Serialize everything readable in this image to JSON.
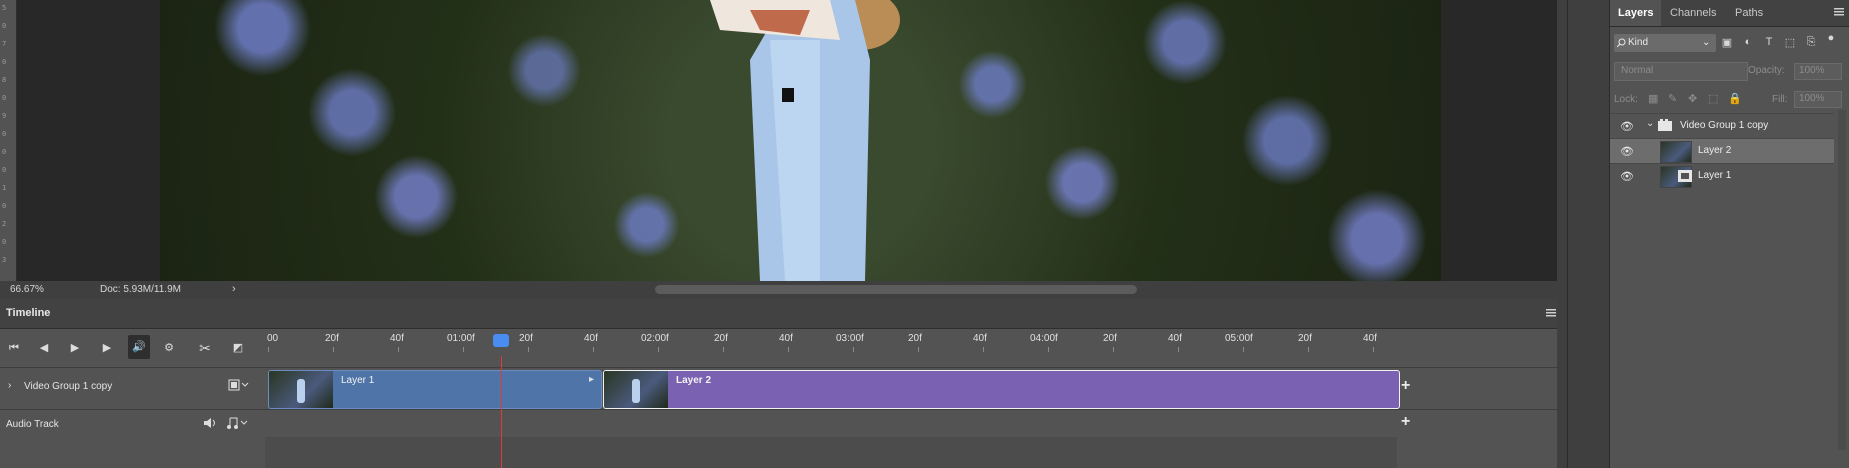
{
  "canvas": {
    "ruler_labels": [
      "5",
      "0",
      "7",
      "0",
      "8",
      "0",
      "9",
      "0",
      "0",
      "0",
      "1",
      "0",
      "2",
      "0",
      "3"
    ]
  },
  "status_bar": {
    "zoom": "66.67%",
    "doc_size": "Doc: 5.93M/11.9M",
    "arrow": "›"
  },
  "timeline": {
    "title": "Timeline",
    "controls": {
      "go_first": "⏮",
      "prev_frame": "◀",
      "play": "▶",
      "next_frame": "▶",
      "mute": "🔊",
      "settings": "⚙",
      "split": "✂",
      "transition": "◩"
    },
    "ruler": [
      "00",
      "20f",
      "40f",
      "01:00f",
      "20f",
      "40f",
      "02:00f",
      "20f",
      "40f",
      "03:00f",
      "20f",
      "40f",
      "04:00f",
      "20f",
      "40f",
      "05:00f",
      "20f",
      "40f"
    ],
    "playhead_time": "01:08f",
    "tracks": {
      "video_group": "Video Group 1 copy",
      "audio": "Audio Track"
    },
    "clips": [
      {
        "name": "Layer 1",
        "color": "#4f74a7"
      },
      {
        "name": "Layer 2",
        "color": "#7b61b2"
      }
    ],
    "add_symbol": "+"
  },
  "layers_panel": {
    "tabs": [
      "Layers",
      "Channels",
      "Paths"
    ],
    "active_tab": "Layers",
    "filter_kind": "Kind",
    "blend_mode": "Normal",
    "opacity_label": "Opacity:",
    "opacity_value": "100%",
    "lock_label": "Lock:",
    "fill_label": "Fill:",
    "fill_value": "100%",
    "layers": [
      {
        "name": "Video Group 1 copy",
        "type": "group",
        "selected": false
      },
      {
        "name": "Layer 2",
        "type": "video",
        "selected": true
      },
      {
        "name": "Layer 1",
        "type": "video",
        "selected": false
      }
    ]
  }
}
